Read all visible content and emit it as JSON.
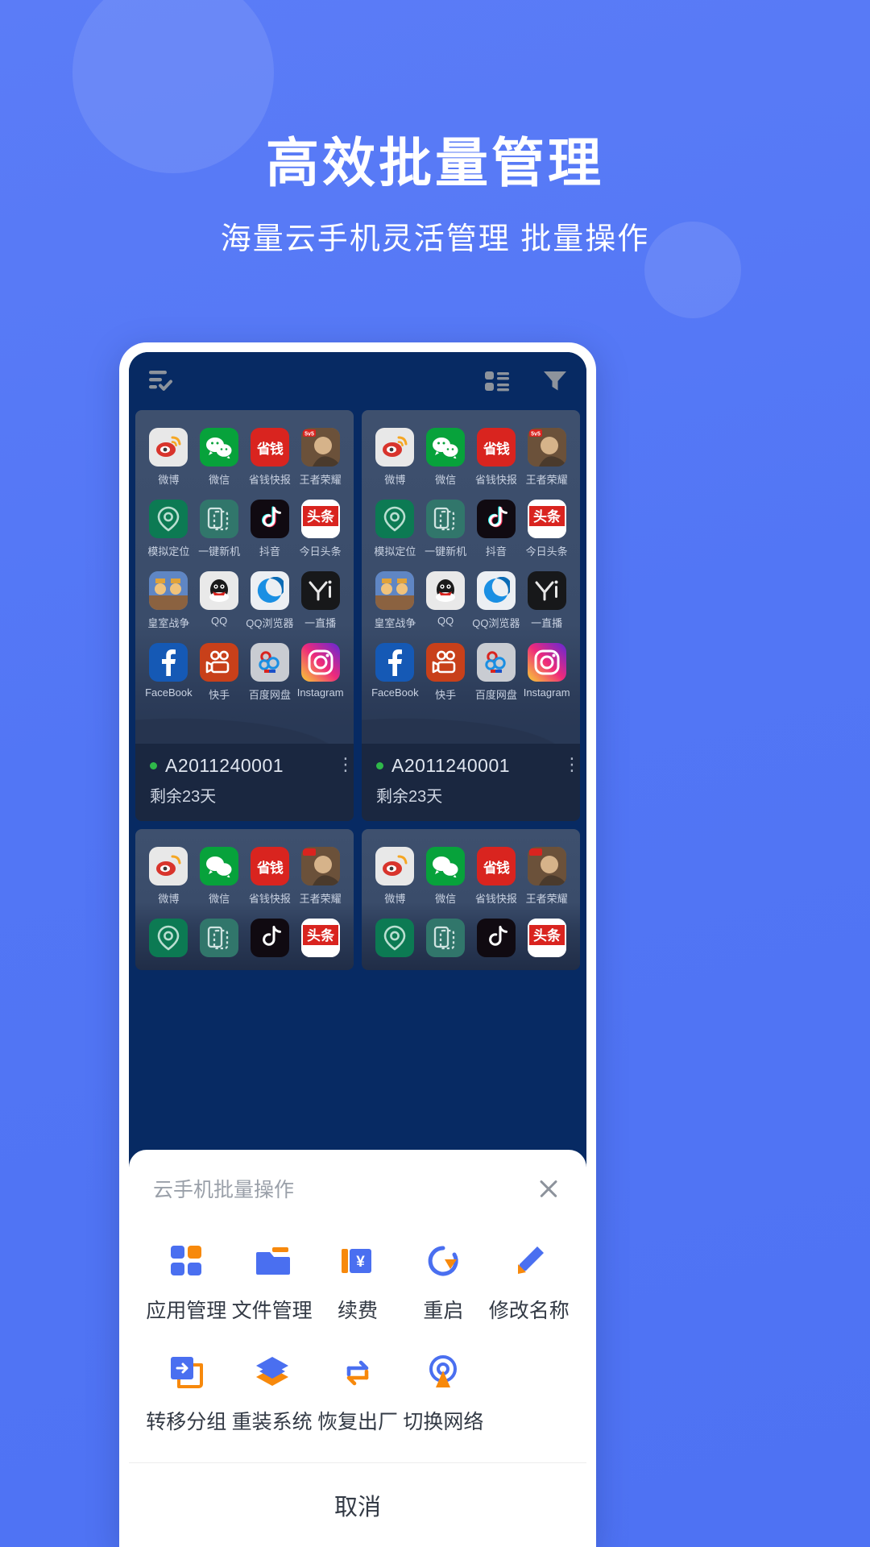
{
  "hero": {
    "title": "高效批量管理",
    "subtitle": "海量云手机灵活管理 批量操作"
  },
  "colors": {
    "background": "#5276f5",
    "accent_blue": "#4a6ff0",
    "accent_orange": "#f7890c",
    "screen_dark": "#072a63",
    "status_online": "#2fb84a"
  },
  "appbar": {
    "select_all_icon": "list-check-icon",
    "layout_icon": "list-view-icon",
    "filter_icon": "filter-funnel-icon"
  },
  "apps": [
    {
      "name": "微博",
      "icon": "weibo-icon"
    },
    {
      "name": "微信",
      "icon": "wechat-icon"
    },
    {
      "name": "省钱快报",
      "icon": "shengqian-icon"
    },
    {
      "name": "王者荣耀",
      "icon": "wangzhe-icon"
    },
    {
      "name": "模拟定位",
      "icon": "location-icon"
    },
    {
      "name": "一键新机",
      "icon": "newphone-icon"
    },
    {
      "name": "抖音",
      "icon": "douyin-icon"
    },
    {
      "name": "今日头条",
      "icon": "toutiao-icon"
    },
    {
      "name": "皇室战争",
      "icon": "clashroyale-icon"
    },
    {
      "name": "QQ",
      "icon": "qq-icon"
    },
    {
      "name": "QQ浏览器",
      "icon": "qqbrowser-icon"
    },
    {
      "name": "一直播",
      "icon": "yizhibo-icon"
    },
    {
      "name": "FaceBook",
      "icon": "facebook-icon"
    },
    {
      "name": "快手",
      "icon": "kuaishou-icon"
    },
    {
      "name": "百度网盘",
      "icon": "baidupan-icon"
    },
    {
      "name": "Instagram",
      "icon": "instagram-icon"
    }
  ],
  "devices": [
    {
      "name": "A2011240001",
      "remaining": "剩余23天",
      "status": "online"
    },
    {
      "name": "A2011240001",
      "remaining": "剩余23天",
      "status": "online"
    }
  ],
  "sheet": {
    "title": "云手机批量操作",
    "close_icon": "close-icon",
    "cancel_label": "取消",
    "actions": [
      {
        "label": "应用管理",
        "icon": "apps-grid-icon"
      },
      {
        "label": "文件管理",
        "icon": "folder-icon"
      },
      {
        "label": "续费",
        "icon": "renew-yen-icon"
      },
      {
        "label": "重启",
        "icon": "restart-icon"
      },
      {
        "label": "修改名称",
        "icon": "pencil-edit-icon"
      },
      {
        "label": "转移分组",
        "icon": "move-group-icon"
      },
      {
        "label": "重装系统",
        "icon": "layers-reinstall-icon"
      },
      {
        "label": "恢复出厂",
        "icon": "factory-reset-icon"
      },
      {
        "label": "切换网络",
        "icon": "switch-network-icon"
      }
    ]
  }
}
